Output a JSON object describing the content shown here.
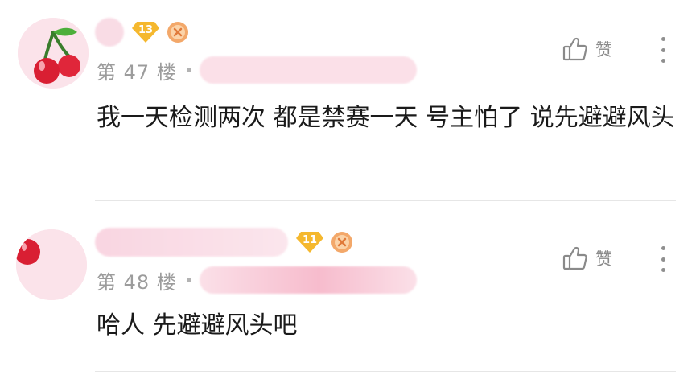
{
  "comments": [
    {
      "level": "13",
      "floor": "第 47 楼",
      "like_label": "赞",
      "content": "我一天检测两次 都是禁赛一天 号主怕了 说先避避风头"
    },
    {
      "level": "11",
      "floor": "第 48 楼",
      "like_label": "赞",
      "content": "哈人 先避避风头吧"
    }
  ],
  "colors": {
    "level_badge": "#f5b82e",
    "floor_text": "#9c9c9c",
    "content_text": "#1a1a1a",
    "icon_gray": "#8a8a8a"
  },
  "icons": [
    "cherry-avatar",
    "level-badge-icon",
    "medal-icon",
    "thumbs-up-icon",
    "more-vertical-icon"
  ]
}
